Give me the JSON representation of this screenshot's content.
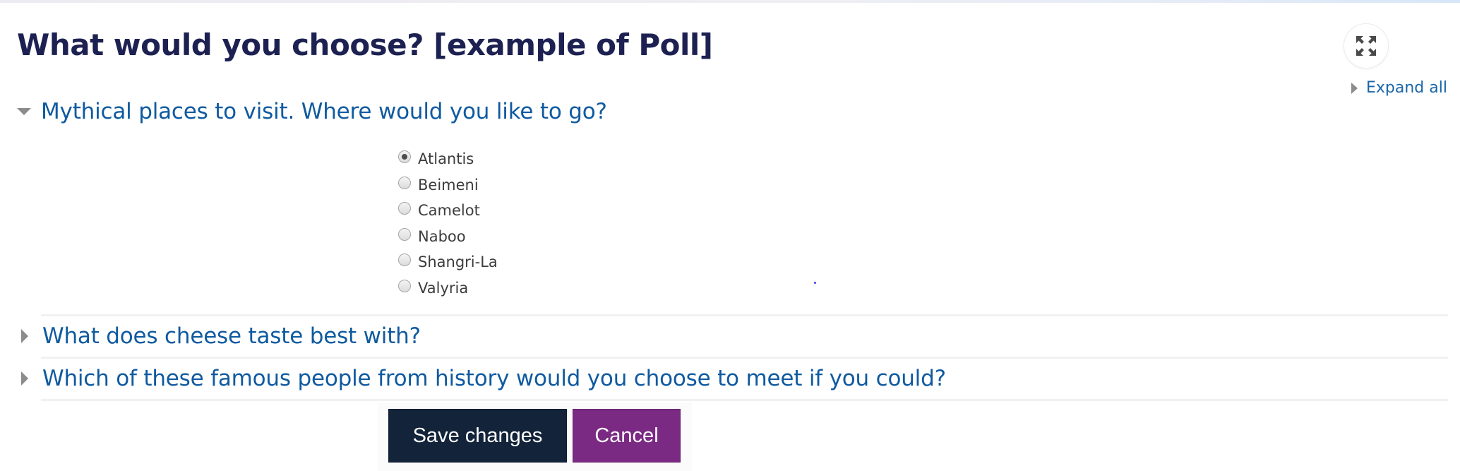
{
  "page": {
    "title": "What would you choose? [example of Poll]"
  },
  "toolbar": {
    "fullscreen_icon": "expand-arrows-icon",
    "expand_all_label": "Expand all"
  },
  "sections": [
    {
      "title": "Mythical places to visit. Where would you like to go?",
      "expanded": true,
      "options": [
        {
          "label": "Atlantis",
          "checked": true
        },
        {
          "label": "Beimeni",
          "checked": false
        },
        {
          "label": "Camelot",
          "checked": false
        },
        {
          "label": "Naboo",
          "checked": false
        },
        {
          "label": "Shangri-La",
          "checked": false
        },
        {
          "label": "Valyria",
          "checked": false
        }
      ]
    },
    {
      "title": "What does cheese taste best with?",
      "expanded": false
    },
    {
      "title": "Which of these famous people from history would you choose to meet if you could?",
      "expanded": false
    }
  ],
  "buttons": {
    "save_label": "Save changes",
    "cancel_label": "Cancel"
  },
  "colors": {
    "title": "#1d2152",
    "link": "#0f5aa0",
    "save_button": "#12233a",
    "cancel_button": "#7b2a83"
  }
}
